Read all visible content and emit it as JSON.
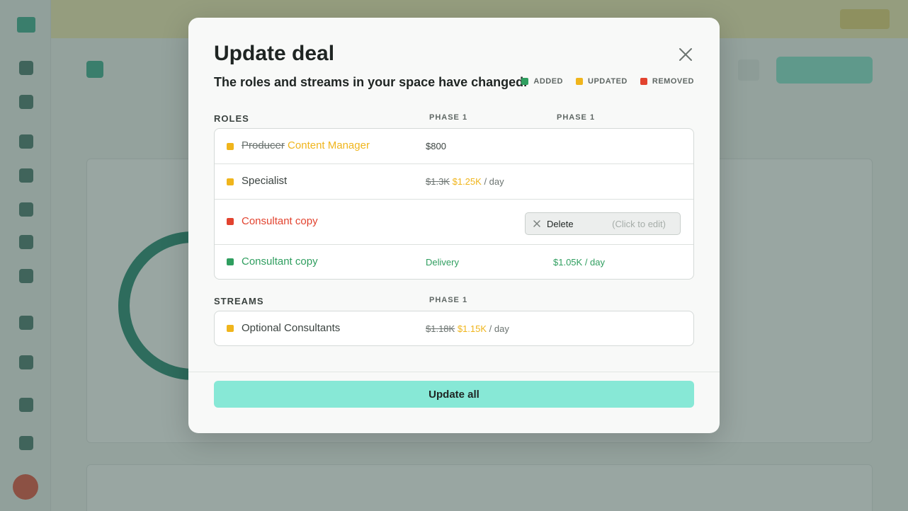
{
  "colors": {
    "added": "#2f9e5f",
    "updated": "#f0b51c",
    "removed": "#e2432f",
    "primary_button": "#87e8d6",
    "brand": "#2ea787"
  },
  "modal": {
    "title": "Update deal",
    "subtitle": "The roles and streams in your space have changed.",
    "close_icon": "close-icon",
    "legend": [
      {
        "label": "ADDED",
        "status": "added"
      },
      {
        "label": "UPDATED",
        "status": "updated"
      },
      {
        "label": "REMOVED",
        "status": "removed"
      }
    ],
    "roles": {
      "header": "ROLES",
      "col1": "PHASE 1",
      "col2": "PHASE 1",
      "rows": [
        {
          "status": "updated",
          "old_name": "Producer",
          "new_name": "Content Manager",
          "phase1": "$800"
        },
        {
          "status": "updated",
          "name": "Specialist",
          "old_rate": "$1.3K",
          "new_rate": "$1.25K",
          "unit": "/ day"
        },
        {
          "status": "removed",
          "name": "Consultant copy",
          "action": "Delete",
          "hint": "(Click to edit)"
        },
        {
          "status": "added",
          "name": "Consultant copy",
          "phase1": "Delivery",
          "phase1b": "$1.05K / day"
        }
      ]
    },
    "streams": {
      "header": "STREAMS",
      "col1": "PHASE 1",
      "rows": [
        {
          "status": "updated",
          "name": "Optional Consultants",
          "old_rate": "$1.18K",
          "new_rate": "$1.15K",
          "unit": "/ day"
        }
      ]
    },
    "update_button": "Update all"
  }
}
